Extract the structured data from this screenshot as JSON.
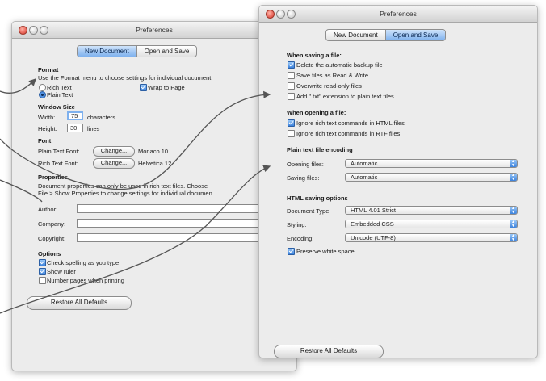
{
  "left_window": {
    "title": "Preferences",
    "tabs": [
      "New Document",
      "Open and Save"
    ],
    "selected_tab": "New Document",
    "format": {
      "header": "Format",
      "description": "Use the Format menu to choose settings for individual document",
      "rich_text": "Rich Text",
      "plain_text": "Plain Text",
      "wrap_to_page": "Wrap to Page"
    },
    "window_size": {
      "header": "Window Size",
      "width_label": "Width:",
      "width_value": "75",
      "width_unit": "characters",
      "height_label": "Height:",
      "height_value": "30",
      "height_unit": "lines"
    },
    "font": {
      "header": "Font",
      "plain_label": "Plain Text Font:",
      "plain_button": "Change...",
      "plain_value": "Monaco 10",
      "rich_label": "Rich Text Font:",
      "rich_button": "Change...",
      "rich_value": "Helvetica 12"
    },
    "properties": {
      "header": "Properties",
      "desc1": "Document properties can only be used in rich text files. Choose",
      "desc2": "File > Show Properties to change settings for individual documen",
      "author": "Author:",
      "company": "Company:",
      "copyright": "Copyright:"
    },
    "options": {
      "header": "Options",
      "check_spelling": "Check spelling as you type",
      "show_ruler": "Show ruler",
      "number_pages": "Number pages when printing"
    },
    "restore": "Restore All Defaults"
  },
  "right_window": {
    "title": "Preferences",
    "tabs": [
      "New Document",
      "Open and Save"
    ],
    "selected_tab": "Open and Save",
    "saving": {
      "header": "When saving a file:",
      "delete_backup": "Delete the automatic backup file",
      "read_write": "Save files as Read & Write",
      "overwrite": "Overwrite read-only files",
      "add_txt": "Add \".txt\" extension to plain text files"
    },
    "opening": {
      "header": "When opening a file:",
      "ignore_html": "Ignore rich text commands in HTML files",
      "ignore_rtf": "Ignore rich text commands in RTF files"
    },
    "encoding": {
      "header": "Plain text file encoding",
      "opening_label": "Opening files:",
      "opening_value": "Automatic",
      "saving_label": "Saving files:",
      "saving_value": "Automatic"
    },
    "html": {
      "header": "HTML saving options",
      "doctype_label": "Document Type:",
      "doctype_value": "HTML 4.01 Strict",
      "styling_label": "Styling:",
      "styling_value": "Embedded CSS",
      "encoding_label": "Encoding:",
      "encoding_value": "Unicode (UTF-8)",
      "preserve": "Preserve white space"
    },
    "restore": "Restore All Defaults"
  },
  "checkbox_states": {
    "plain_text_selected": true,
    "wrap_to_page": true,
    "check_spelling": true,
    "show_ruler": true,
    "number_pages": false,
    "delete_backup": true,
    "read_write": false,
    "overwrite": false,
    "add_txt": false,
    "ignore_html": true,
    "ignore_rtf": false,
    "preserve": true
  },
  "colors": {
    "selected_tab": "#7fb1ee",
    "checkbox_on": "#3c82dc",
    "close_button": "#d8352a",
    "annotation_line": "#555555"
  }
}
